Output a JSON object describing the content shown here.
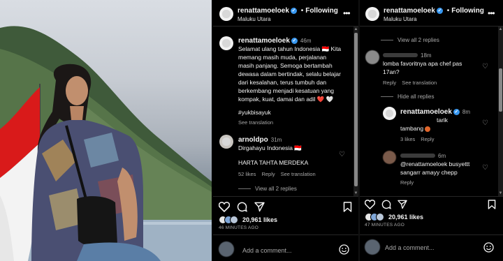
{
  "photo": {
    "flag_colors": [
      "#d91a1a",
      "#ffffff"
    ]
  },
  "panel1": {
    "header": {
      "username": "renattamoeloek",
      "follow": "Following",
      "location": "Maluku Utara"
    },
    "caption": {
      "username": "renattamoeloek",
      "time": "46m",
      "lines": [
        "Selamat ulang tahun Indonesia 🇮🇩 Kita",
        "memang masih muda, perjalanan",
        "masih panjang. Semoga bertambah",
        "dewasa dalam bertindak, selalu belajar",
        "dari kesalahan, terus tumbuh dan",
        "berkembang menjadi kesatuan yang",
        "kompak, kuat, damai dan adil ❤️ 🤍"
      ],
      "hashtag": "#yukbisayuk",
      "see_translation": "See translation"
    },
    "comment": {
      "username": "arnoldpo",
      "time": "31m",
      "line1": "Dirgahayu Indonesia 🇮🇩",
      "line2": "HARTA TAHTA MERDEKA",
      "likes": "52 likes",
      "reply": "Reply",
      "see_translation": "See translation",
      "view_replies": "View all 2 replies"
    },
    "likes": "20,961 likes",
    "ago": "46 MINUTES AGO",
    "add_comment": "Add a comment..."
  },
  "panel2": {
    "header": {
      "username": "renattamoeloek",
      "follow": "Following",
      "location": "Maluku Utara"
    },
    "view_replies_top": "View all 2 replies",
    "comment1": {
      "time": "18m",
      "line1": "lomba favoritnya apa chef pas",
      "line2": "17an?",
      "reply": "Reply",
      "see_translation": "See translation"
    },
    "hide_replies": "Hide all replies",
    "reply1": {
      "username": "renattamoeloek",
      "time": "8m",
      "line1": "tarik",
      "line2": "tambang",
      "likes": "3 likes",
      "reply": "Reply"
    },
    "reply2": {
      "time": "6m",
      "line1": "@renattamoeloek busyettt",
      "line2": "sangarr amayy chepp",
      "reply": "Reply"
    },
    "likes": "20,961 likes",
    "ago": "47 MINUTES AGO",
    "add_comment": "Add a comment..."
  },
  "icons": [
    "heart-icon",
    "comment-icon",
    "share-icon",
    "bookmark-icon",
    "emoji-icon",
    "more-icon",
    "verified-icon"
  ],
  "colors": {
    "verified": "#3797f0",
    "background": "#000000",
    "muted": "#a8a8a8"
  }
}
